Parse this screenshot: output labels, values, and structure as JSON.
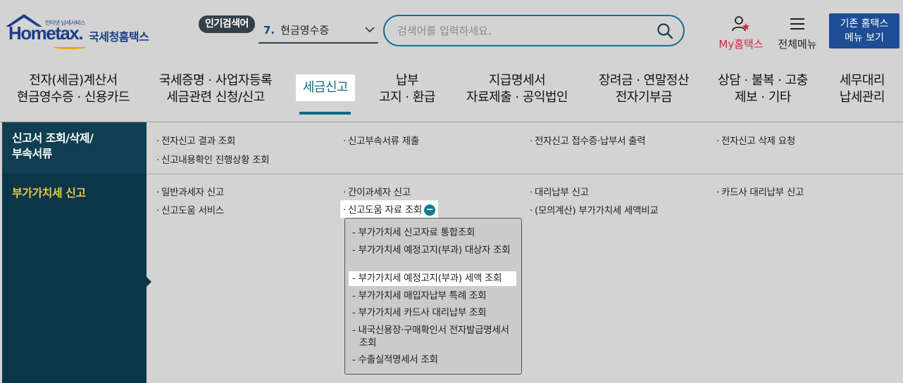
{
  "header": {
    "logo_tagline": "인터넷 납세서비스",
    "logo_brand": "Hometax.",
    "logo_brand_ko": "국세청홈택스",
    "popular_badge": "인기검색어",
    "popular_rank": "7.",
    "popular_term": "현금영수증",
    "search_placeholder": "검색어를 입력하세요.",
    "my_hometax": "My홈택스",
    "all_menu": "전체메뉴",
    "old_home_line1": "기존 홈택스",
    "old_home_line2": "메뉴 보기"
  },
  "gnb": [
    {
      "line1": "전자(세금)계산서",
      "line2": "현금영수증 · 신용카드"
    },
    {
      "line1": "국세증명 · 사업자등록",
      "line2": "세금관련 신청/신고"
    },
    {
      "line1": "세금신고",
      "line2": ""
    },
    {
      "line1": "납부",
      "line2": "고지 · 환급"
    },
    {
      "line1": "지급명세서",
      "line2": "자료제출 · 공익법인"
    },
    {
      "line1": "장려금 · 연말정산",
      "line2": "전자기부금"
    },
    {
      "line1": "상담 · 불복 · 고충",
      "line2": "제보 · 기타"
    },
    {
      "line1": "세무대리",
      "line2": "납세관리"
    }
  ],
  "categories": {
    "cat1_line1": "신고서 조회/삭제/",
    "cat1_line2": "부속서류",
    "cat2": "부가가치세 신고"
  },
  "row1_links": [
    "전자신고 결과 조회",
    "신고부속서류 제출",
    "전자신고 접수증·납부서 출력",
    "전자신고 삭제 요청",
    "신고내용확인 진행상황 조회"
  ],
  "row2_links": [
    "일반과세자 신고",
    "간이과세자 신고",
    "대리납부 신고",
    "카드사 대리납부 신고",
    "신고도움 서비스",
    "신고도움 자료 조회",
    "(모의계산) 부가가치세 세액비교"
  ],
  "bullet": "·",
  "minus_glyph": "−",
  "submenu": [
    "부가가치세 신고자료 통합조회",
    "부가가치세 예정고지(부과) 대상자 조회",
    "부가가치세 예정고지(부과) 세액 조회",
    "부가가치세 매입자납부 특례 조회",
    "부가가치세 카드사 대리납부 조회",
    "내국신용장·구매확인서 전자발급명세서 조회",
    "수출실적명세서 조회"
  ],
  "sub_dash": "- ",
  "colors": {
    "brand": "#1b3e8a",
    "accent": "#0f6b7f",
    "nav_dark": "#0b3647",
    "highlight_yellow": "#e8c94a",
    "my_red": "#d6263f"
  }
}
